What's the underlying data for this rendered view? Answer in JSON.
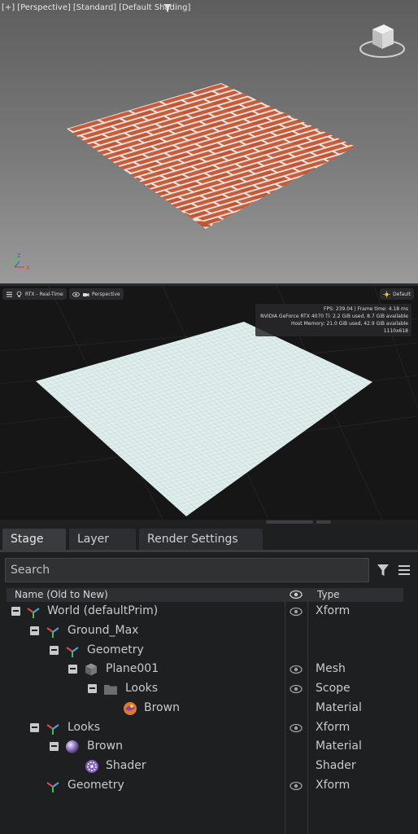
{
  "max_viewport": {
    "labels": [
      "[+]",
      "[Perspective]",
      "[Standard]",
      "[Default Shading]"
    ],
    "icons": {
      "filter": "filter-icon",
      "viewcube": "viewcube-icon",
      "gizmo": "axis-gizmo-icon"
    },
    "gizmo_axes": [
      "Y",
      "Z",
      "X"
    ]
  },
  "ov_viewport": {
    "toolbar_left": {
      "icon": "settings-icon",
      "render_icon": "bulb-icon",
      "render_mode": "RTX - Real-Time"
    },
    "toolbar_camera": {
      "icon": "eye-icon",
      "camera_icon": "camera-icon",
      "camera": "Perspective"
    },
    "toolbar_right": {
      "icon": "sun-icon",
      "lighting": "Default"
    },
    "stats": [
      "FPS: 239.04  |  Frame time: 4.18 ms",
      "NVIDIA GeForce RTX 4070 Ti: 2.2 GiB used, 8.7 GiB available",
      "Host Memory: 21.0 GiB used, 42.9 GiB available",
      "1110x618"
    ]
  },
  "stage": {
    "tabs": [
      "Stage",
      "Layer",
      "Render Settings"
    ],
    "search_placeholder": "Search",
    "columns": {
      "name": "Name (Old to New)",
      "visibility_icon": "eye-icon",
      "type": "Type"
    },
    "rows": [
      {
        "label": "World (defaultPrim)",
        "type": "Xform",
        "icon": "xform-icon",
        "expanded": true,
        "visible": true
      },
      {
        "label": "Ground_Max",
        "type": "",
        "icon": "xform-icon",
        "expanded": true,
        "visible": false
      },
      {
        "label": "Geometry",
        "type": "",
        "icon": "xform-icon",
        "expanded": true,
        "visible": false
      },
      {
        "label": "Plane001",
        "type": "Mesh",
        "icon": "mesh-cube-icon",
        "expanded": true,
        "visible": true
      },
      {
        "label": "Looks",
        "type": "Scope",
        "icon": "folder-icon",
        "expanded": true,
        "visible": true
      },
      {
        "label": "Brown",
        "type": "Material",
        "icon": "material-swatch-icon",
        "expanded": false,
        "visible": false
      },
      {
        "label": "Looks",
        "type": "Xform",
        "icon": "xform-icon",
        "expanded": true,
        "visible": true
      },
      {
        "label": "Brown",
        "type": "Material",
        "icon": "material-sphere-icon",
        "expanded": true,
        "visible": false
      },
      {
        "label": "Shader",
        "type": "Shader",
        "icon": "shader-gear-icon",
        "expanded": false,
        "visible": false
      },
      {
        "label": "Geometry",
        "type": "Xform",
        "icon": "xform-icon",
        "expanded": false,
        "visible": true
      }
    ]
  }
}
